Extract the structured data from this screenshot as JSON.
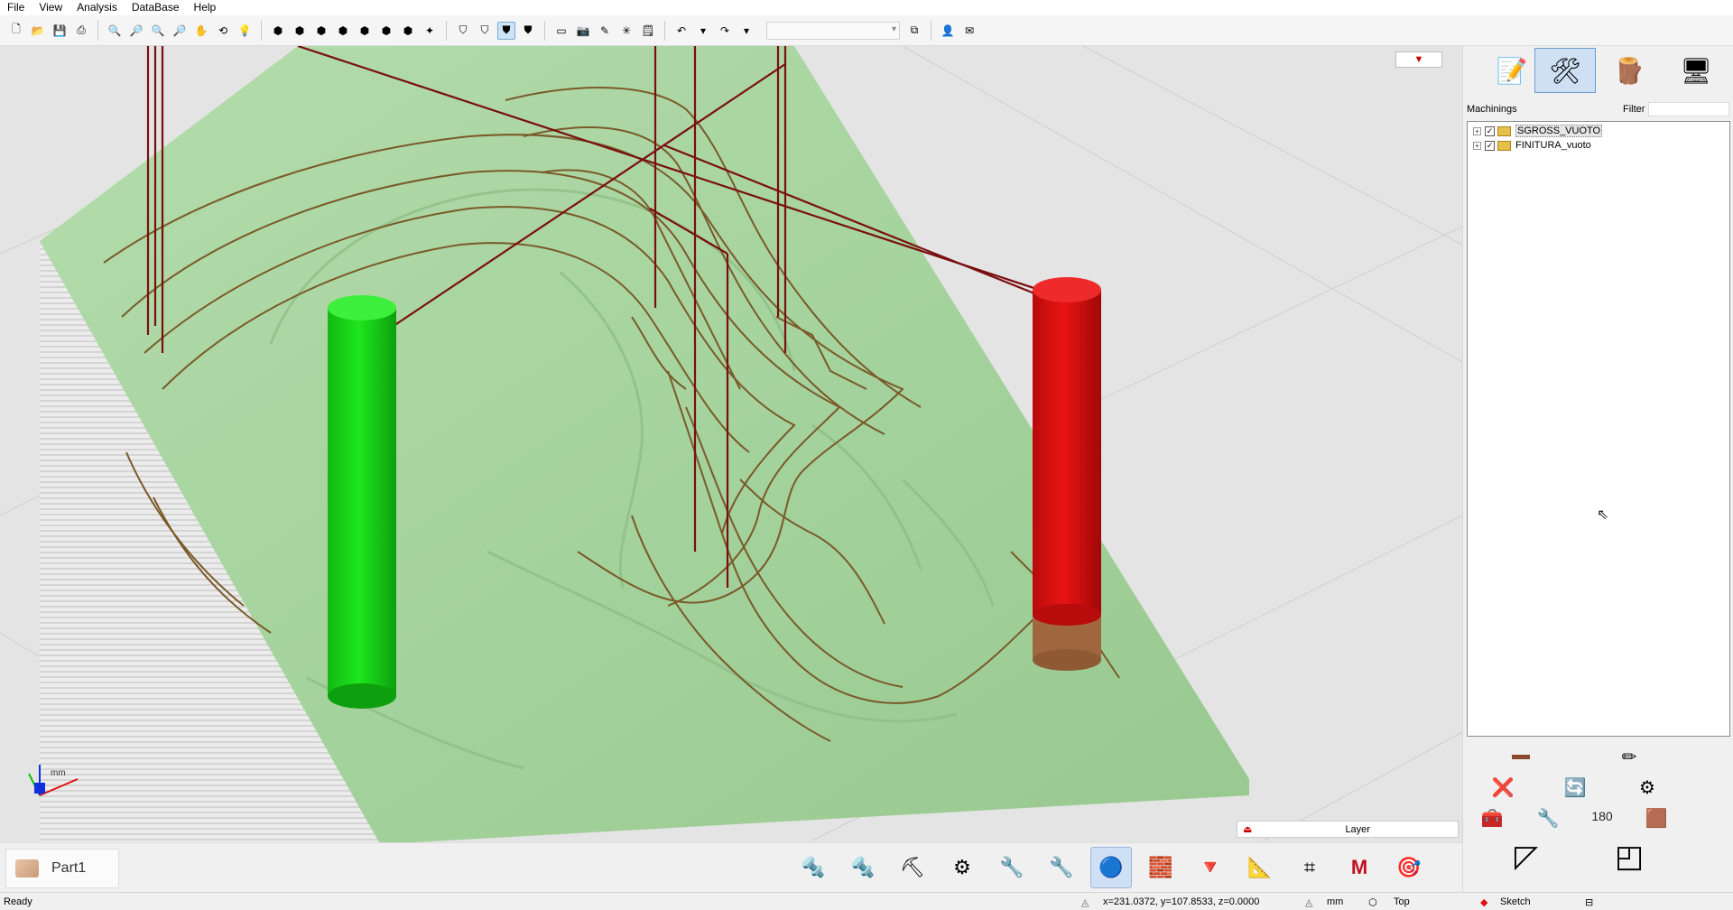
{
  "menu": {
    "file": "File",
    "view": "View",
    "analysis": "Analysis",
    "database": "DataBase",
    "help": "Help"
  },
  "toolbar": {
    "combo_value": ""
  },
  "viewport": {
    "axis_unit": "mm"
  },
  "layer_bar": {
    "label": "Layer"
  },
  "part_tab": {
    "label": "Part1"
  },
  "right_panel": {
    "machinings_label": "Machinings",
    "filter_label": "Filter",
    "filter_value": "",
    "tree": [
      {
        "label": "SGROSS_VUOTO",
        "checked": "✓",
        "selected": true
      },
      {
        "label": "FINITURA_vuoto",
        "checked": "✓",
        "selected": false
      }
    ],
    "rotate_value": "180"
  },
  "status": {
    "ready": "Ready",
    "coords": "x=231.0372, y=107.8533, z=0.0000",
    "units": "mm",
    "view": "Top",
    "mode": "Sketch"
  },
  "colors": {
    "model": "#a7d4a0",
    "toolpath": "#7a5a2a",
    "rapid": "#7a0f0f",
    "start_marker": "#1ee61e",
    "end_marker": "#e01010",
    "selected_bg": "#cfe0f5"
  }
}
